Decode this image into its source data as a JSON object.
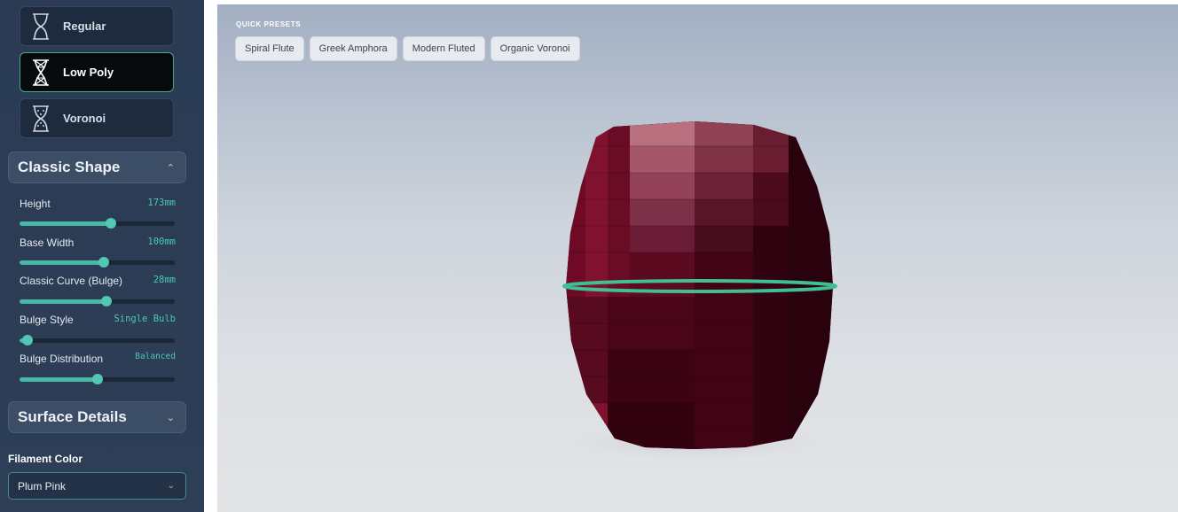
{
  "sidebar": {
    "styles": [
      {
        "label": "Regular",
        "icon": "hourglass-regular-icon",
        "active": false
      },
      {
        "label": "Low Poly",
        "icon": "hourglass-lowpoly-icon",
        "active": true
      },
      {
        "label": "Voronoi",
        "icon": "hourglass-voronoi-icon",
        "active": false
      }
    ],
    "classic_shape": {
      "title": "Classic Shape",
      "expanded": true,
      "controls": [
        {
          "label": "Height",
          "value": "173mm",
          "fraction": 0.59
        },
        {
          "label": "Base Width",
          "value": "100mm",
          "fraction": 0.54
        },
        {
          "label": "Classic Curve (Bulge)",
          "value": "28mm",
          "fraction": 0.56
        },
        {
          "label": "Bulge Style",
          "value": "Single Bulb",
          "fraction": 0.05
        },
        {
          "label": "Bulge Distribution",
          "value": "Balanced",
          "fraction": 0.5
        }
      ]
    },
    "surface_details": {
      "title": "Surface Details",
      "expanded": false
    },
    "filament": {
      "label": "Filament Color",
      "selected": "Plum Pink"
    }
  },
  "viewport": {
    "presets_title": "QUICK PRESETS",
    "presets": [
      "Spiral Flute",
      "Greek Amphora",
      "Modern Fluted",
      "Organic Voronoi"
    ],
    "model": {
      "color": "#7a0f2a",
      "ring_color": "#3fbf94",
      "facets": "low-poly"
    }
  },
  "colors": {
    "accent": "#45b8a6",
    "sidebar_bg": "#2a3b53"
  }
}
